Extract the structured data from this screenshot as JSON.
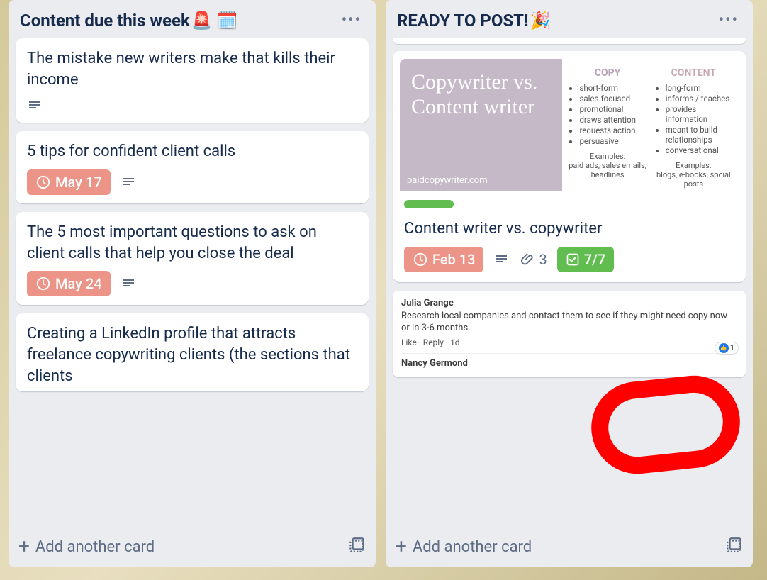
{
  "lists": [
    {
      "title": "Content due this week",
      "title_emojis": "🚨 🗓️",
      "cards": [
        {
          "title": "The mistake new writers make that kills their income",
          "has_desc": true
        },
        {
          "title": "5 tips for confident client calls",
          "due": "May 17",
          "has_desc": true
        },
        {
          "title": "The 5 most important questions to ask on client calls that help you close the deal",
          "due": "May 24",
          "has_desc": true
        },
        {
          "title": "Creating a LinkedIn profile that attracts freelance copywriting clients (the sections that clients"
        }
      ]
    },
    {
      "title": "READY TO POST!",
      "title_emojis": "🎉",
      "cards": [
        {
          "cover": {
            "left_title": "Copywriter vs. Content writer",
            "left_site": "paidcopywriter.com",
            "copy_title": "COPY",
            "copy_items": [
              "short-form",
              "sales-focused",
              "promotional",
              "draws attention",
              "requests action",
              "persuasive"
            ],
            "copy_examples_label": "Examples:",
            "copy_examples": "paid ads, sales emails, headlines",
            "content_title": "CONTENT",
            "content_items": [
              "long-form",
              "informs / teaches",
              "provides information",
              "meant to build relationships",
              "conversational"
            ],
            "content_examples_label": "Examples:",
            "content_examples": "blogs, e-books, social posts"
          },
          "label_color": "green",
          "title": "Content writer vs. copywriter",
          "due": "Feb 13",
          "has_desc": true,
          "attach_count": "3",
          "checklist": "7/7"
        },
        {
          "comment": {
            "author1": "Julia Grange",
            "text1": "Research local companies and contact them to see if they might need copy now or in 3-6 months.",
            "actions1": "Like · Reply · 1d",
            "reaction_count": "1",
            "author2": "Nancy Germond"
          }
        }
      ]
    }
  ],
  "ui": {
    "add_card": "Add another card",
    "menu_dots": "•••"
  }
}
